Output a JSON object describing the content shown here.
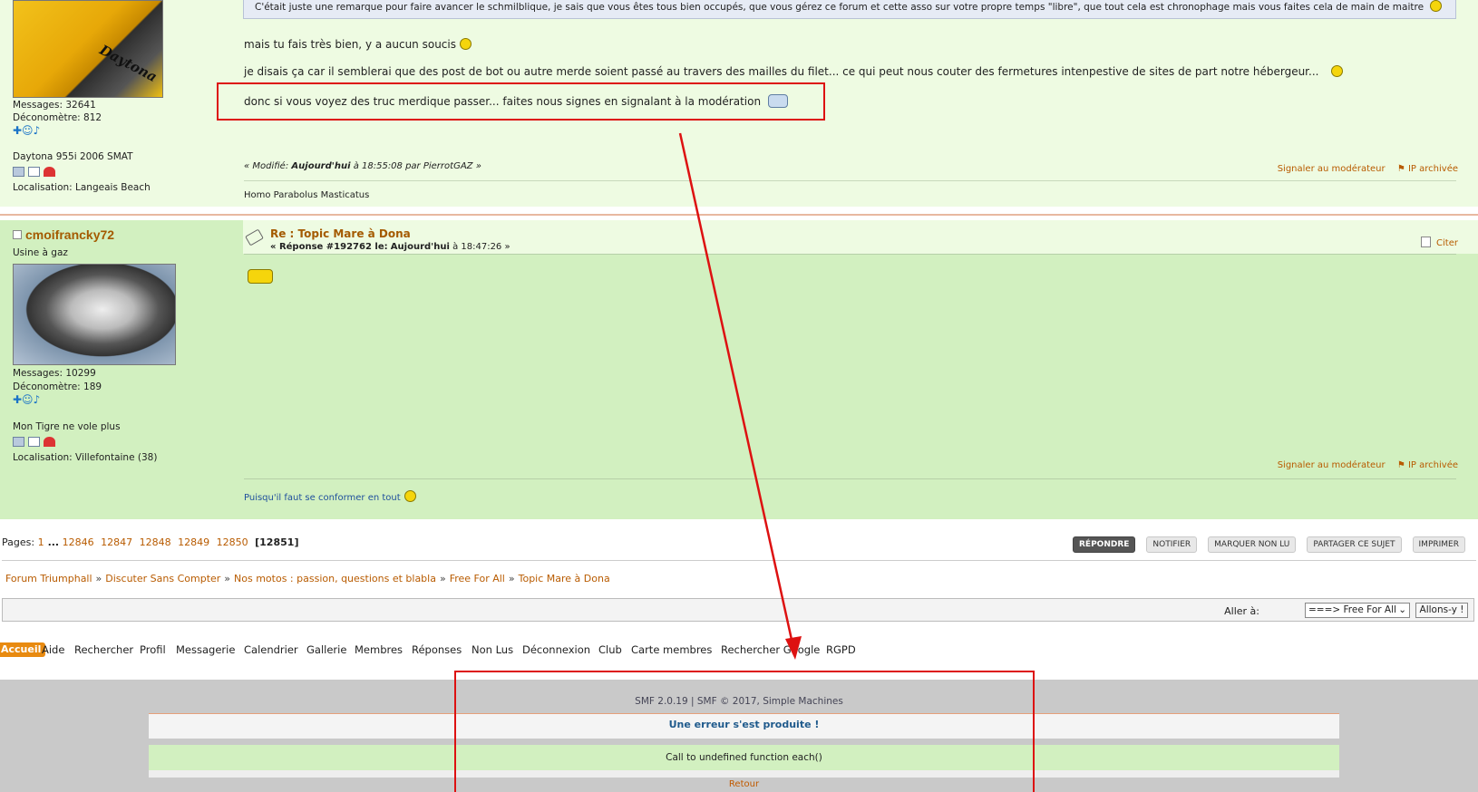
{
  "post1": {
    "poster": {
      "avatar_text": "Daytona",
      "messages": "Messages: 32641",
      "deconometre": "Déconomètre: 812",
      "bike": "Daytona 955i 2006 SMAT",
      "location": "Localisation: Langeais Beach"
    },
    "quote_text": "C'était juste une remarque pour faire avancer le schmilblique, je sais que vous êtes tous bien occupés, que vous gérez ce forum et cette asso sur votre propre temps \"libre\", que tout cela est chronophage mais vous faites cela de main de maitre",
    "lines": [
      "mais tu fais très bien, y a aucun soucis",
      "je disais ça car il semblerai que des post de bot ou autre merde soient passé au travers des mailles du filet...  ce qui peut nous couter des fermetures intenpestive de sites de part notre hébergeur...",
      "donc si vous voyez des truc merdique passer...  faites nous signes en signalant à la modération"
    ],
    "modified_prefix": "« Modifié:",
    "modified_when": "Aujourd'hui",
    "modified_rest": "à 18:55:08 par PierrotGAZ »",
    "report": "Signaler au modérateur",
    "ip": "IP archivée",
    "signature": "Homo Parabolus Masticatus"
  },
  "post2": {
    "poster": {
      "name": "cmoifrancky72",
      "group": "Usine à gaz",
      "messages": "Messages: 10299",
      "deconometre": "Déconomètre: 189",
      "bike": "Mon Tigre ne vole plus",
      "location": "Localisation: Villefontaine (38)"
    },
    "title": "Re : Topic Mare à Dona",
    "reply_prefix": "« Réponse #192762 le:",
    "reply_when": "Aujourd'hui",
    "reply_rest": "à 18:47:26 »",
    "quote_btn": "Citer",
    "report": "Signaler au modérateur",
    "ip": "IP archivée",
    "signature": "Puisqu'il faut se conformer en tout"
  },
  "pagination": {
    "label": "Pages:",
    "first": "1",
    "ellipsis": "...",
    "pages": [
      "12846",
      "12847",
      "12848",
      "12849",
      "12850"
    ],
    "current": "12851"
  },
  "buttons": [
    "RÉPONDRE",
    "NOTIFIER",
    "MARQUER NON LU",
    "PARTAGER CE SUJET",
    "IMPRIMER"
  ],
  "breadcrumb": [
    "Forum Triumphall",
    "Discuter Sans Compter",
    "Nos motos : passion, questions et blabla",
    "Free For All",
    "Topic Mare à Dona"
  ],
  "breadcrumb_sep": "»",
  "jump": {
    "label": "Aller à:",
    "selected": "===> Free For All",
    "go": "Allons-y !"
  },
  "nav": [
    "Accueil",
    "Aide",
    "Rechercher",
    "Profil",
    "Messagerie",
    "Calendrier",
    "Gallerie",
    "Membres",
    "Réponses",
    "Non Lus",
    "Déconnexion",
    "Club",
    "Carte membres",
    "Rechercher Google",
    "RGPD"
  ],
  "footer": {
    "copyright": "SMF 2.0.19 | SMF © 2017, Simple Machines",
    "error_title": "Une erreur s'est produite !",
    "error_message": "Call to undefined function each()",
    "back": "Retour"
  },
  "colors": {
    "link": "#b85b00",
    "annotation": "#d11111",
    "post_bg": "#d2f0c0",
    "footer_bg": "#c9c9c9"
  }
}
